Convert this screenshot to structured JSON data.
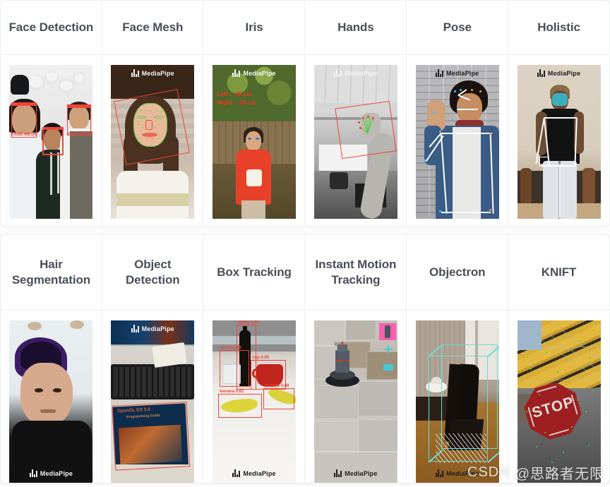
{
  "watermark": {
    "site": "CSDN",
    "author": "@思路者无限",
    "brand": "MediaPipe"
  },
  "tables": [
    {
      "id": "perception-solutions",
      "columns": [
        {
          "label": "Face Detection",
          "demo_name": "face-detection-demo",
          "watermark_position": "top",
          "watermark_style": "light",
          "overlay_labels": [
            "FACE MESH",
            "FACE MESH"
          ]
        },
        {
          "label": "Face Mesh",
          "demo_name": "face-mesh-demo",
          "watermark_position": "top",
          "watermark_style": "light",
          "overlay_labels": []
        },
        {
          "label": "Iris",
          "demo_name": "iris-demo",
          "watermark_position": "top",
          "watermark_style": "light",
          "overlay_labels": [
            "Left : :78 cm",
            "Right : :79 cm"
          ]
        },
        {
          "label": "Hands",
          "demo_name": "hands-demo",
          "watermark_position": "top",
          "watermark_style": "light",
          "overlay_labels": []
        },
        {
          "label": "Pose",
          "demo_name": "pose-demo",
          "watermark_position": "top",
          "watermark_style": "dark",
          "overlay_labels": []
        },
        {
          "label": "Holistic",
          "demo_name": "holistic-demo",
          "watermark_position": "top",
          "watermark_style": "dark",
          "overlay_labels": []
        }
      ]
    },
    {
      "id": "tracking-solutions",
      "columns": [
        {
          "label": "Hair Segmentation",
          "demo_name": "hair-segmentation-demo",
          "watermark_position": "bottom",
          "watermark_style": "light",
          "overlay_labels": []
        },
        {
          "label": "Object Detection",
          "demo_name": "object-detection-demo",
          "watermark_position": "top",
          "watermark_style": "light",
          "overlay_labels": [
            "OpenGL ES 3.0",
            "Programming Guide"
          ]
        },
        {
          "label": "Box Tracking",
          "demo_name": "box-tracking-demo",
          "watermark_position": "bottom",
          "watermark_style": "dark",
          "overlay_labels": [
            "bottle 0.86",
            "bottle 0.66",
            "cup 0.90",
            "banana 0.81",
            "banana 0.80"
          ]
        },
        {
          "label": "Instant Motion Tracking",
          "demo_name": "instant-motion-tracking-demo",
          "watermark_position": "bottom",
          "watermark_style": "dark",
          "overlay_labels": []
        },
        {
          "label": "Objectron",
          "demo_name": "objectron-demo",
          "watermark_position": "bottom",
          "watermark_style": "dark",
          "overlay_labels": []
        },
        {
          "label": "KNIFT",
          "demo_name": "knift-demo",
          "watermark_position": "none",
          "watermark_style": "light",
          "overlay_labels": [
            "STOP"
          ]
        }
      ]
    }
  ],
  "colors": {
    "accent_red": "#f0453a",
    "accent_green": "#62d049",
    "accent_cyan": "#6fdad2",
    "accent_pink": "#f95fae",
    "border": "#eceef0",
    "header_text": "#4a4f57",
    "surface": "#ffffff",
    "page_background": "#fbfbfb"
  }
}
